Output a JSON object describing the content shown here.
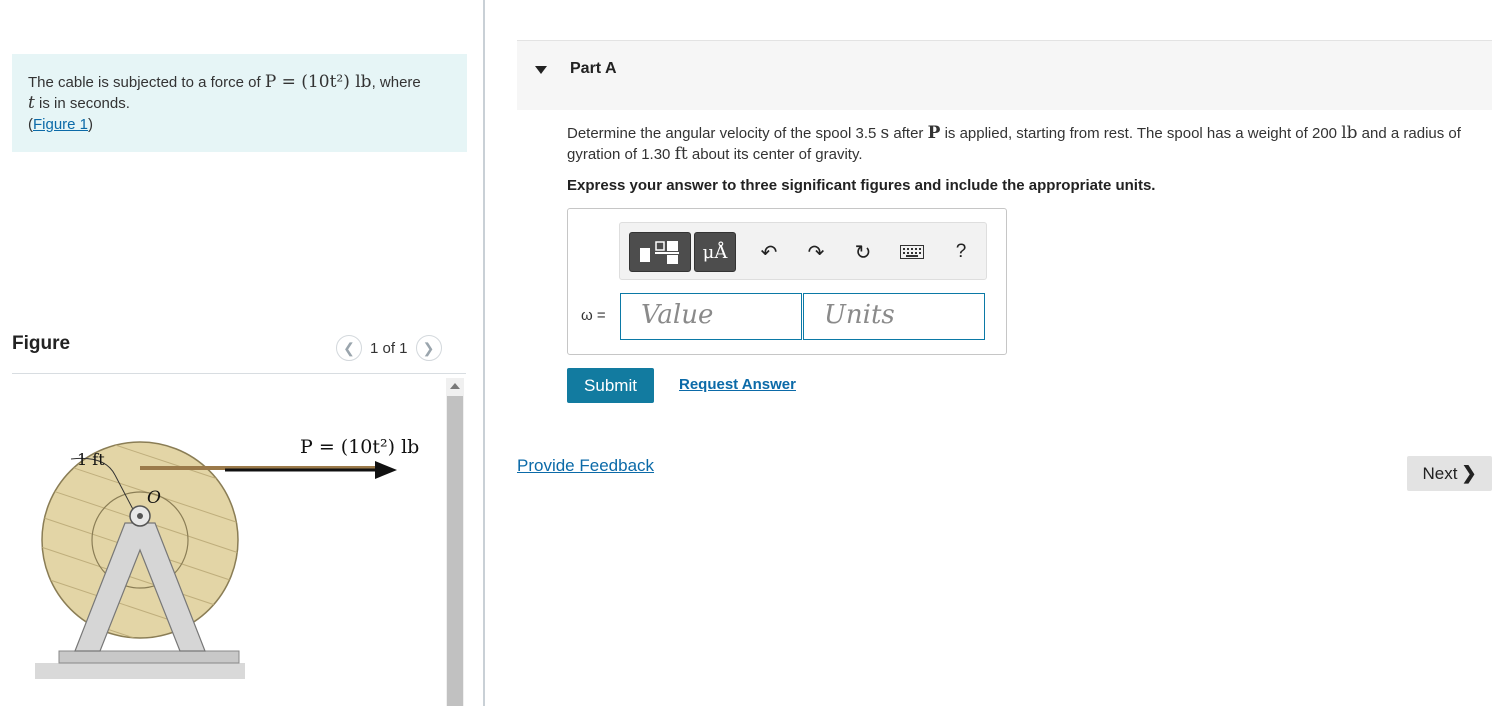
{
  "problem": {
    "text_before": "The cable is subjected to a force of ",
    "formula": "P = (10t²) lb",
    "text_after": ", where",
    "variable": "t",
    "text_line2": " is in seconds.",
    "figure_link": "Figure 1"
  },
  "figure": {
    "heading": "Figure",
    "pager_text": "1 of 1",
    "force_label": "P = (10t²) lb",
    "radius_label": "1 ft",
    "center_label": "O"
  },
  "part": {
    "title": "Part A",
    "question_1": "Determine the angular velocity of the spool 3.5 ",
    "unit_s": "s",
    "question_2": " after ",
    "bold_P": "P",
    "question_3": " is applied, starting from rest. The spool has a weight of 200 ",
    "unit_lb": "lb",
    "question_4": " and a radius of gyration of 1.30 ",
    "unit_ft": "ft",
    "question_5": " about its center of gravity.",
    "instruction": "Express your answer to three significant figures and include the appropriate units."
  },
  "toolbar": {
    "units_label": "μÅ",
    "help_label": "?",
    "icons": [
      "templates-icon",
      "units-icon",
      "undo-icon",
      "redo-icon",
      "reset-icon",
      "keyboard-icon",
      "help-icon"
    ]
  },
  "answer": {
    "variable_label": "ω =",
    "value_placeholder": "Value",
    "units_placeholder": "Units"
  },
  "actions": {
    "submit": "Submit",
    "request": "Request Answer",
    "feedback": "Provide Feedback",
    "next": "Next"
  },
  "colors": {
    "problem_bg": "#e6f5f6",
    "accent": "#127ba0",
    "link": "#0b6aa8",
    "spool": "#e3d5a6"
  }
}
